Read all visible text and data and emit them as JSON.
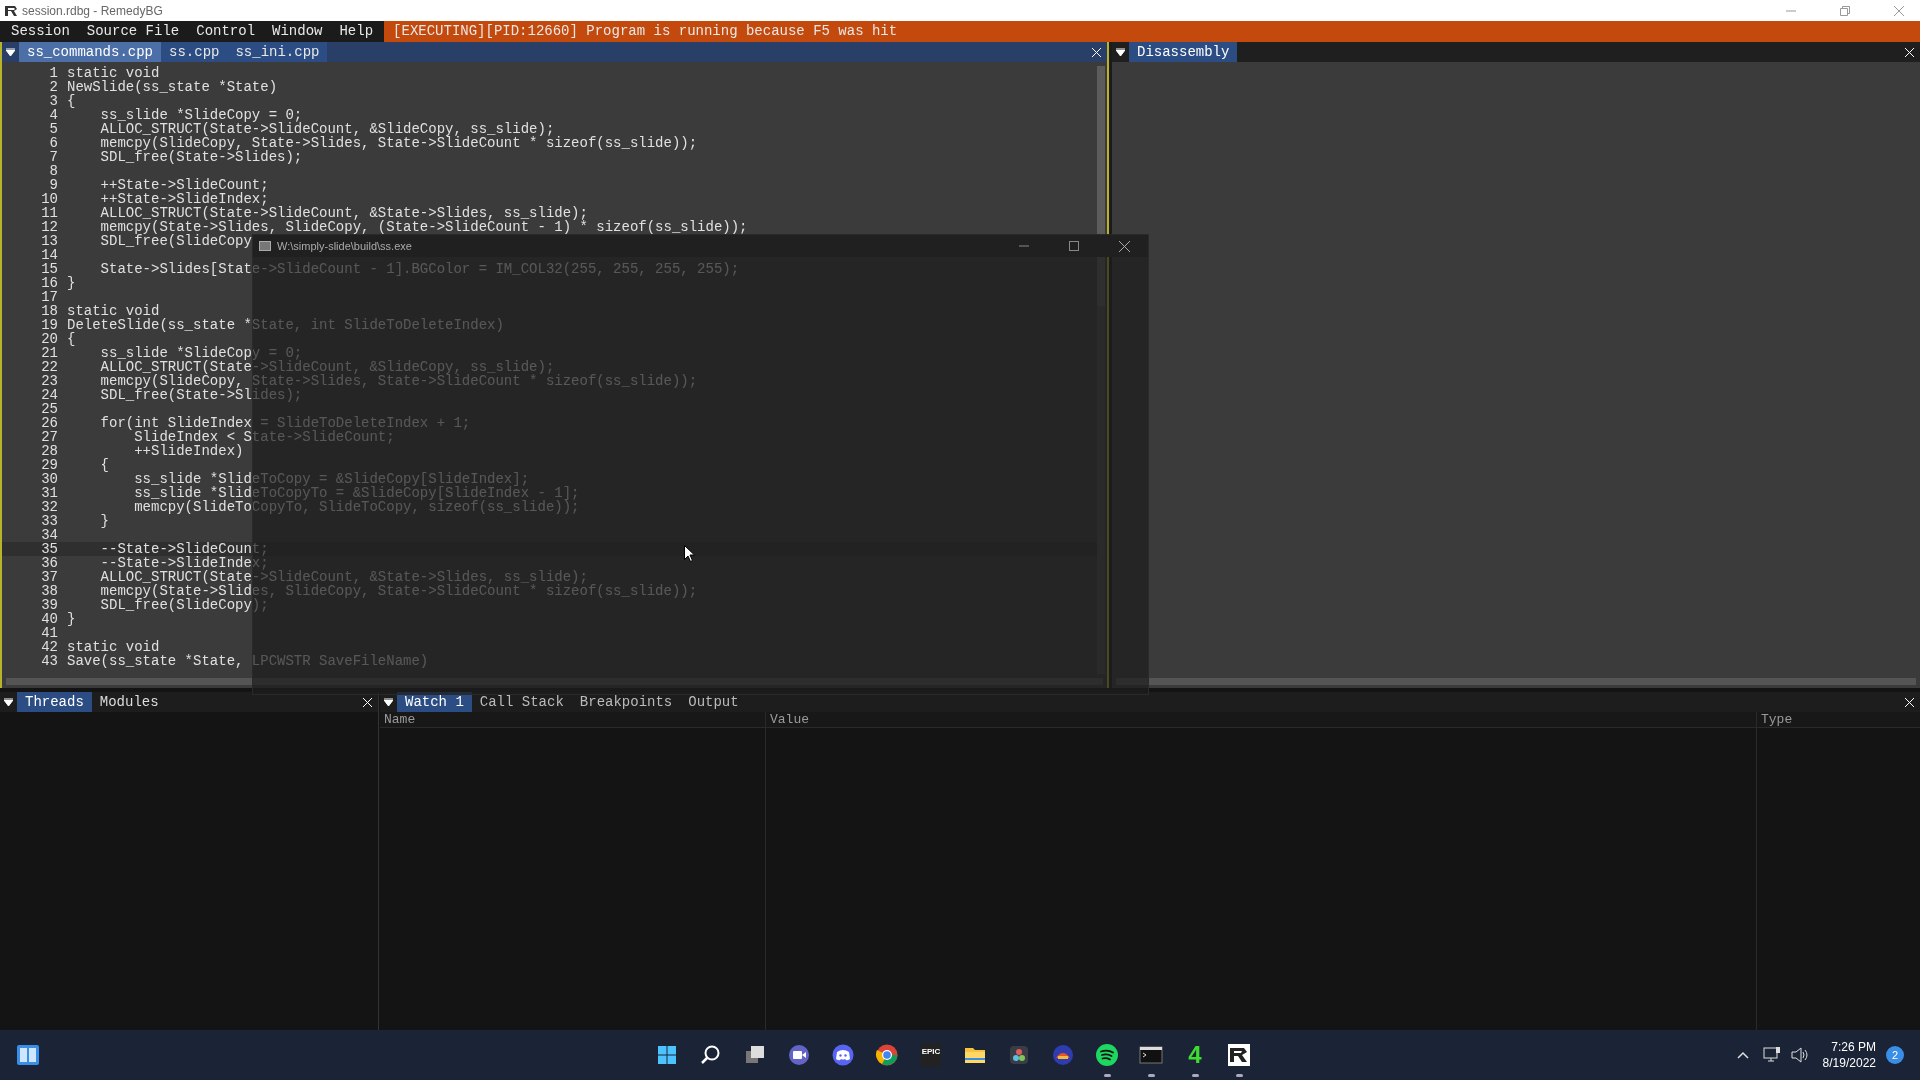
{
  "window": {
    "title": "session.rdbg - RemedyBG"
  },
  "menu": [
    "Session",
    "Source File",
    "Control",
    "Window",
    "Help"
  ],
  "status": "[EXECUTING][PID:12660] Program is running because F5 was hit",
  "editor": {
    "tabs": [
      {
        "label": "ss_commands.cpp",
        "selected": true
      },
      {
        "label": "ss.cpp",
        "selected": false
      },
      {
        "label": "ss_ini.cpp",
        "selected": false
      }
    ],
    "lines": [
      {
        "n": "1",
        "code": "static void",
        "current": false
      },
      {
        "n": "2",
        "code": "NewSlide(ss_state *State)",
        "current": false
      },
      {
        "n": "3",
        "code": "{",
        "current": false
      },
      {
        "n": "4",
        "code": "    ss_slide *SlideCopy = 0;",
        "current": false
      },
      {
        "n": "5",
        "code": "    ALLOC_STRUCT(State->SlideCount, &SlideCopy, ss_slide);",
        "current": false
      },
      {
        "n": "6",
        "code": "    memcpy(SlideCopy, State->Slides, State->SlideCount * sizeof(ss_slide));",
        "current": false
      },
      {
        "n": "7",
        "code": "    SDL_free(State->Slides);",
        "current": false
      },
      {
        "n": "8",
        "current": false
      },
      {
        "n": "9",
        "code": "    ++State->SlideCount;",
        "current": false
      },
      {
        "n": "10",
        "code": "    ++State->SlideIndex;",
        "current": false
      },
      {
        "n": "11",
        "code": "    ALLOC_STRUCT(State->SlideCount, &State->Slides, ss_slide);",
        "current": false
      },
      {
        "n": "12",
        "code": "    memcpy(State->Slides, SlideCopy, (State->SlideCount - 1) * sizeof(ss_slide));",
        "current": false
      },
      {
        "n": "13",
        "code": "    SDL_free(SlideCopy",
        "current": false
      },
      {
        "n": "14",
        "current": false
      },
      {
        "n": "15",
        "code": "    State->Slides[State->SlideCount - 1].BGColor = IM_COL32(255, 255, 255, 255);",
        "current": false
      },
      {
        "n": "16",
        "code": "}",
        "current": false
      },
      {
        "n": "17",
        "current": false
      },
      {
        "n": "18",
        "code": "static void",
        "current": false
      },
      {
        "n": "19",
        "code": "DeleteSlide(ss_state *State, int SlideToDeleteIndex)",
        "current": false
      },
      {
        "n": "20",
        "code": "{",
        "current": false
      },
      {
        "n": "21",
        "code": "    ss_slide *SlideCopy = 0;",
        "current": false
      },
      {
        "n": "22",
        "code": "    ALLOC_STRUCT(State->SlideCount, &SlideCopy, ss_slide);",
        "current": false
      },
      {
        "n": "23",
        "code": "    memcpy(SlideCopy, State->Slides, State->SlideCount * sizeof(ss_slide));",
        "current": false
      },
      {
        "n": "24",
        "code": "    SDL_free(State->Slides);",
        "current": false
      },
      {
        "n": "25",
        "current": false
      },
      {
        "n": "26",
        "code": "    for(int SlideIndex = SlideToDeleteIndex + 1;",
        "current": false
      },
      {
        "n": "27",
        "code": "        SlideIndex < State->SlideCount;",
        "current": false
      },
      {
        "n": "28",
        "code": "        ++SlideIndex)",
        "current": false
      },
      {
        "n": "29",
        "code": "    {",
        "current": false
      },
      {
        "n": "30",
        "code": "        ss_slide *SlideToCopy = &SlideCopy[SlideIndex];",
        "current": false
      },
      {
        "n": "31",
        "code": "        ss_slide *SlideToCopyTo = &SlideCopy[SlideIndex - 1];",
        "current": false
      },
      {
        "n": "32",
        "code": "        memcpy(SlideToCopyTo, SlideToCopy, sizeof(ss_slide));",
        "current": false
      },
      {
        "n": "33",
        "code": "    }",
        "current": false
      },
      {
        "n": "34",
        "current": false
      },
      {
        "n": "35",
        "code": "    --State->SlideCount;",
        "current": true
      },
      {
        "n": "36",
        "code": "    --State->SlideIndex;",
        "current": false
      },
      {
        "n": "37",
        "code": "    ALLOC_STRUCT(State->SlideCount, &State->Slides, ss_slide);",
        "current": false
      },
      {
        "n": "38",
        "code": "    memcpy(State->Slides, SlideCopy, State->SlideCount * sizeof(ss_slide));",
        "current": false
      },
      {
        "n": "39",
        "code": "    SDL_free(SlideCopy);",
        "current": false
      },
      {
        "n": "40",
        "code": "}",
        "current": false
      },
      {
        "n": "41",
        "current": false
      },
      {
        "n": "42",
        "code": "static void",
        "current": false
      },
      {
        "n": "43",
        "code": "Save(ss_state *State, LPCWSTR SaveFileName)",
        "current": false
      }
    ]
  },
  "disassembly": {
    "tabs": [
      {
        "label": "Disassembly",
        "selected": true
      }
    ]
  },
  "program_window": {
    "title": "W:\\simply-slide\\build\\ss.exe"
  },
  "threads_panel": {
    "tabs": [
      {
        "label": "Threads",
        "selected": true
      },
      {
        "label": "Modules",
        "selected": false
      }
    ]
  },
  "watch_panel": {
    "tabs": [
      {
        "label": "Watch 1",
        "selected": true
      },
      {
        "label": "Call Stack",
        "selected": false
      },
      {
        "label": "Breakpoints",
        "selected": false
      },
      {
        "label": "Output",
        "selected": false
      }
    ],
    "columns": [
      "Name",
      "Value",
      "Type"
    ]
  },
  "taskbar": {
    "apps": [
      {
        "kind": "start",
        "running": false
      },
      {
        "kind": "search",
        "running": false
      },
      {
        "kind": "taskview",
        "running": false
      },
      {
        "kind": "video",
        "running": false
      },
      {
        "kind": "chat",
        "running": false
      },
      {
        "kind": "browser",
        "running": false
      },
      {
        "kind": "store",
        "label": "EPIC",
        "running": false
      },
      {
        "kind": "folder",
        "running": false
      },
      {
        "kind": "editor",
        "running": false
      },
      {
        "kind": "game",
        "running": false
      },
      {
        "kind": "music",
        "running": true
      },
      {
        "kind": "terminal",
        "running": true
      },
      {
        "kind": "text",
        "label": "4",
        "running": true
      },
      {
        "kind": "debugger",
        "running": true
      }
    ],
    "time": "7:26 PM",
    "date": "8/19/2022",
    "notifications": "2"
  }
}
